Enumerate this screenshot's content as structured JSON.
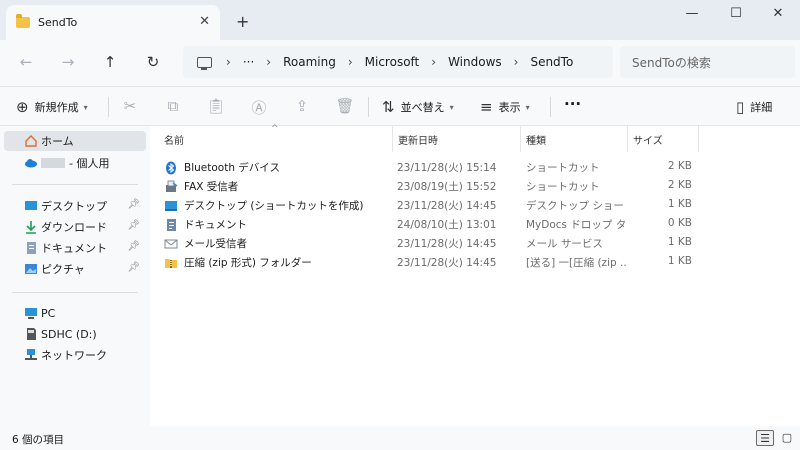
{
  "window": {
    "tab_title": "SendTo",
    "new_tab": "+",
    "tab_close": "✕",
    "minimize": "—",
    "maximize": "☐",
    "close": "✕"
  },
  "address": {
    "crumbs": [
      "Roaming",
      "Microsoft",
      "Windows",
      "SendTo"
    ],
    "overflow": "···",
    "search_placeholder": "SendToの検索"
  },
  "toolbar": {
    "new_label": "新規作成",
    "sort_label": "並べ替え",
    "view_label": "表示",
    "details_label": "詳細",
    "more": "···"
  },
  "sidebar": {
    "home": "ホーム",
    "onedrive_suffix": "- 個人用",
    "quick": [
      {
        "label": "デスクトップ"
      },
      {
        "label": "ダウンロード"
      },
      {
        "label": "ドキュメント"
      },
      {
        "label": "ピクチャ"
      }
    ],
    "devices": [
      {
        "label": "PC"
      },
      {
        "label": "SDHC (D:)"
      },
      {
        "label": "ネットワーク"
      }
    ]
  },
  "columns": {
    "name": "名前",
    "date": "更新日時",
    "type": "種類",
    "size": "サイズ"
  },
  "files": [
    {
      "name": "Bluetooth デバイス",
      "date": "23/11/28(火) 15:14",
      "type": "ショートカット",
      "size": "2 KB",
      "icon": "bluetooth-icon"
    },
    {
      "name": "FAX 受信者",
      "date": "23/08/19(土) 15:52",
      "type": "ショートカット",
      "size": "2 KB",
      "icon": "fax-icon"
    },
    {
      "name": "デスクトップ (ショートカットを作成)",
      "date": "23/11/28(火) 14:45",
      "type": "デスクトップ ショートカ...",
      "size": "1 KB",
      "icon": "desktop-icon"
    },
    {
      "name": "ドキュメント",
      "date": "24/08/10(土) 13:01",
      "type": "MyDocs ドロップ タ...",
      "size": "0 KB",
      "icon": "document-icon"
    },
    {
      "name": "メール受信者",
      "date": "23/11/28(火) 14:45",
      "type": "メール サービス",
      "size": "1 KB",
      "icon": "mail-icon"
    },
    {
      "name": "圧縮 (zip 形式) フォルダー",
      "date": "23/11/28(火) 14:45",
      "type": "[送る] 一[圧縮 (zip ...",
      "size": "1 KB",
      "icon": "zip-folder-icon"
    }
  ],
  "status": {
    "item_count": "6 個の項目"
  }
}
